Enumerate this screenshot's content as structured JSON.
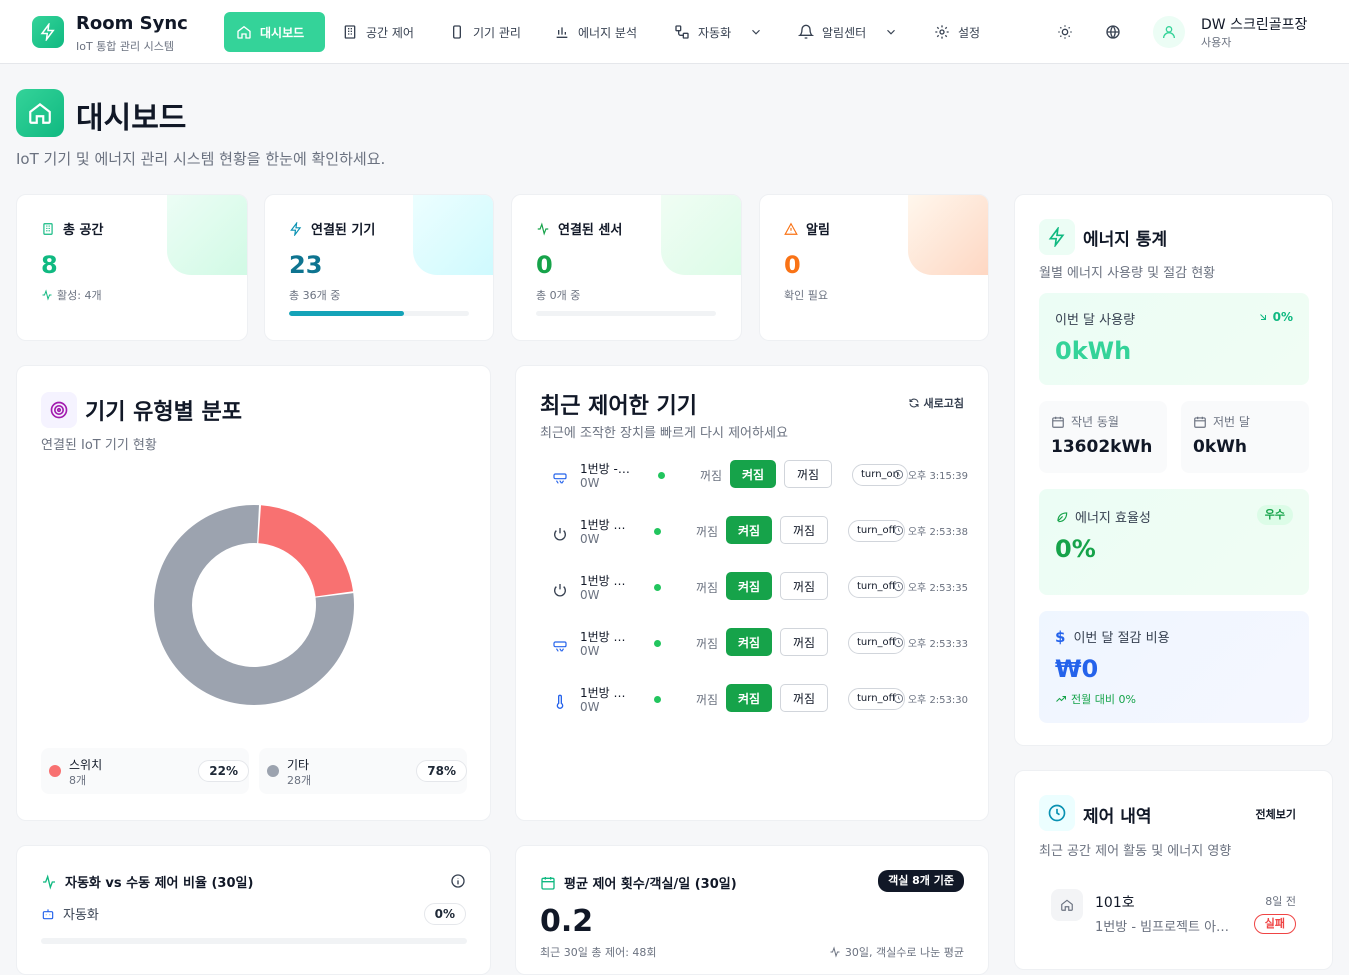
{
  "app": {
    "name": "Room Sync",
    "subtitle": "IoT 통합 관리 시스템"
  },
  "nav": {
    "dashboard": "대시보드",
    "space": "공간 제어",
    "devices": "기기 관리",
    "energy": "에너지 분석",
    "automation": "자동화",
    "alerts": "알림센터",
    "settings": "설정"
  },
  "user": {
    "name": "DW 스크린골프장",
    "role": "사용자"
  },
  "page": {
    "title": "대시보드",
    "subtitle": "IoT 기기 및 에너지 관리 시스템 현황을 한눈에 확인하세요."
  },
  "stats": {
    "spaces": {
      "label": "총 공간",
      "value": "8",
      "sub": "활성: 4개"
    },
    "devices": {
      "label": "연결된 기기",
      "value": "23",
      "sub": "총 36개 중",
      "ratio": 0.64
    },
    "sensors": {
      "label": "연결된 센서",
      "value": "0",
      "sub": "총 0개 중",
      "ratio": 0
    },
    "alerts": {
      "label": "알림",
      "value": "0",
      "sub": "확인 필요"
    }
  },
  "distribution": {
    "title": "기기 유형별 분포",
    "subtitle": "연결된 IoT 기기 현황",
    "legend": [
      {
        "name": "스위치",
        "count": "8개",
        "pct": "22%"
      },
      {
        "name": "기타",
        "count": "28개",
        "pct": "78%"
      }
    ]
  },
  "chart_data": {
    "type": "pie",
    "categories": [
      "스위치",
      "기타"
    ],
    "values": [
      22,
      78
    ],
    "colors": [
      "#f87171",
      "#9ca3af"
    ]
  },
  "recent": {
    "title": "최근 제어한 기기",
    "subtitle": "최근에 조작한 장치를 빠르게 다시 제어하세요",
    "refresh": "새로고침",
    "state_label": "꺼짐",
    "on_label": "켜짐",
    "off_label": "꺼짐",
    "rows": [
      {
        "name": "1번방 - …",
        "power": "0W",
        "icon": "aircon-icon",
        "cmd": "turn_on",
        "time": "오후 3:15:39"
      },
      {
        "name": "1번방 …",
        "power": "0W",
        "icon": "power-icon",
        "cmd": "turn_off",
        "time": "오후 2:53:38"
      },
      {
        "name": "1번방 …",
        "power": "0W",
        "icon": "power-icon",
        "cmd": "turn_off",
        "time": "오후 2:53:35"
      },
      {
        "name": "1번방 …",
        "power": "0W",
        "icon": "aircon-icon",
        "cmd": "turn_off",
        "time": "오후 2:53:33"
      },
      {
        "name": "1번방 …",
        "power": "0W",
        "icon": "thermometer-icon",
        "cmd": "turn_off",
        "time": "오후 2:53:30"
      }
    ]
  },
  "energy": {
    "title": "에너지 통계",
    "subtitle": "월별 에너지 사용량 및 절감 현황",
    "this_month_label": "이번 달 사용량",
    "this_month_value": "0kWh",
    "this_month_change": "0%",
    "last_year_label": "작년 동월",
    "last_year_value": "13602kWh",
    "last_month_label": "저번 달",
    "last_month_value": "0kWh",
    "efficiency_label": "에너지 효율성",
    "efficiency_value": "0%",
    "efficiency_badge": "우수",
    "saving_label": "이번 달 절감 비용",
    "saving_value": "₩0",
    "saving_change": "전월 대비 0%"
  },
  "history": {
    "title": "제어 내역",
    "view_all": "전체보기",
    "subtitle": "최근 공간 제어 활동 및 에너지 영향",
    "item": {
      "room": "101호",
      "desc": "1번방 - 빔프로젝트 아…",
      "time": "8일 전",
      "status": "실패"
    }
  },
  "auto_ratio": {
    "title": "자동화 vs 수동 제어 비율 (30일)",
    "auto_label": "자동화",
    "auto_pct": "0%"
  },
  "avg_ctrl": {
    "title": "평균 제어 횟수/객실/일 (30일)",
    "badge": "객실 8개 기준",
    "value": "0.2",
    "note_left": "최근 30일 총 제어: 48회",
    "note_right": "30일, 객실수로 나눈 평균"
  }
}
